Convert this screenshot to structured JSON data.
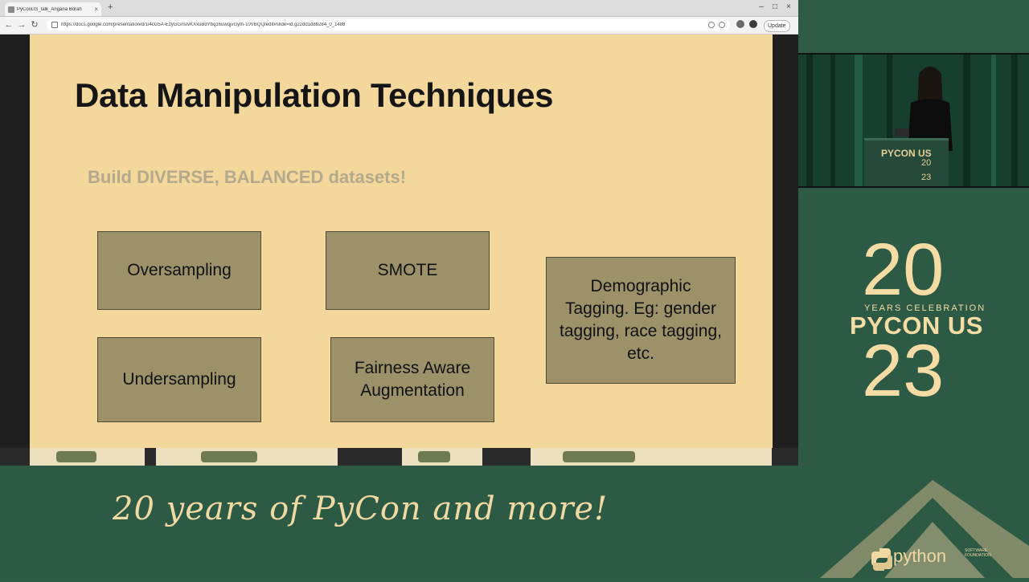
{
  "browser": {
    "tab_title": "PyConUS_talk_Angana Borah",
    "new_tab_symbol": "+",
    "close_symbol": "×",
    "url": "https://docs.google.com/presentation/d/1i4cG5A-EzyGGnsIvKXxuBdYbq16uwqjvGyth-10VBQQ/edit#slide=id.g22dd1d8b284_0_1488",
    "update_label": "Update",
    "nav": {
      "back": "←",
      "forward": "→",
      "reload": "↻"
    },
    "window_controls": {
      "minimize": "–",
      "maximize": "□",
      "close": "×"
    }
  },
  "slide": {
    "title": "Data Manipulation Techniques",
    "subtitle": "Build DIVERSE, BALANCED datasets!",
    "techniques": [
      {
        "label": "Oversampling"
      },
      {
        "label": "SMOTE"
      },
      {
        "label": "Demographic Tagging. Eg: gender tagging, race tagging, etc."
      },
      {
        "label": "Undersampling"
      },
      {
        "label": "Fairness Aware Augmentation"
      }
    ]
  },
  "event": {
    "podium_brand": "PYCON US",
    "podium_year_top": "20",
    "podium_year_bottom": "23",
    "year_top": "20",
    "years_celebration": "YEARS CELEBRATION",
    "brand": "PYCON US",
    "year_bottom": "23",
    "tagline": "20 years of PyCon and more!",
    "python_word": "python",
    "psf_text": "SOFTWARE FOUNDATION"
  },
  "colors": {
    "slide_bg": "#f3d79b",
    "box_fill": "#9c9169",
    "event_green": "#2c5a44",
    "event_cream": "#f5dca5"
  }
}
